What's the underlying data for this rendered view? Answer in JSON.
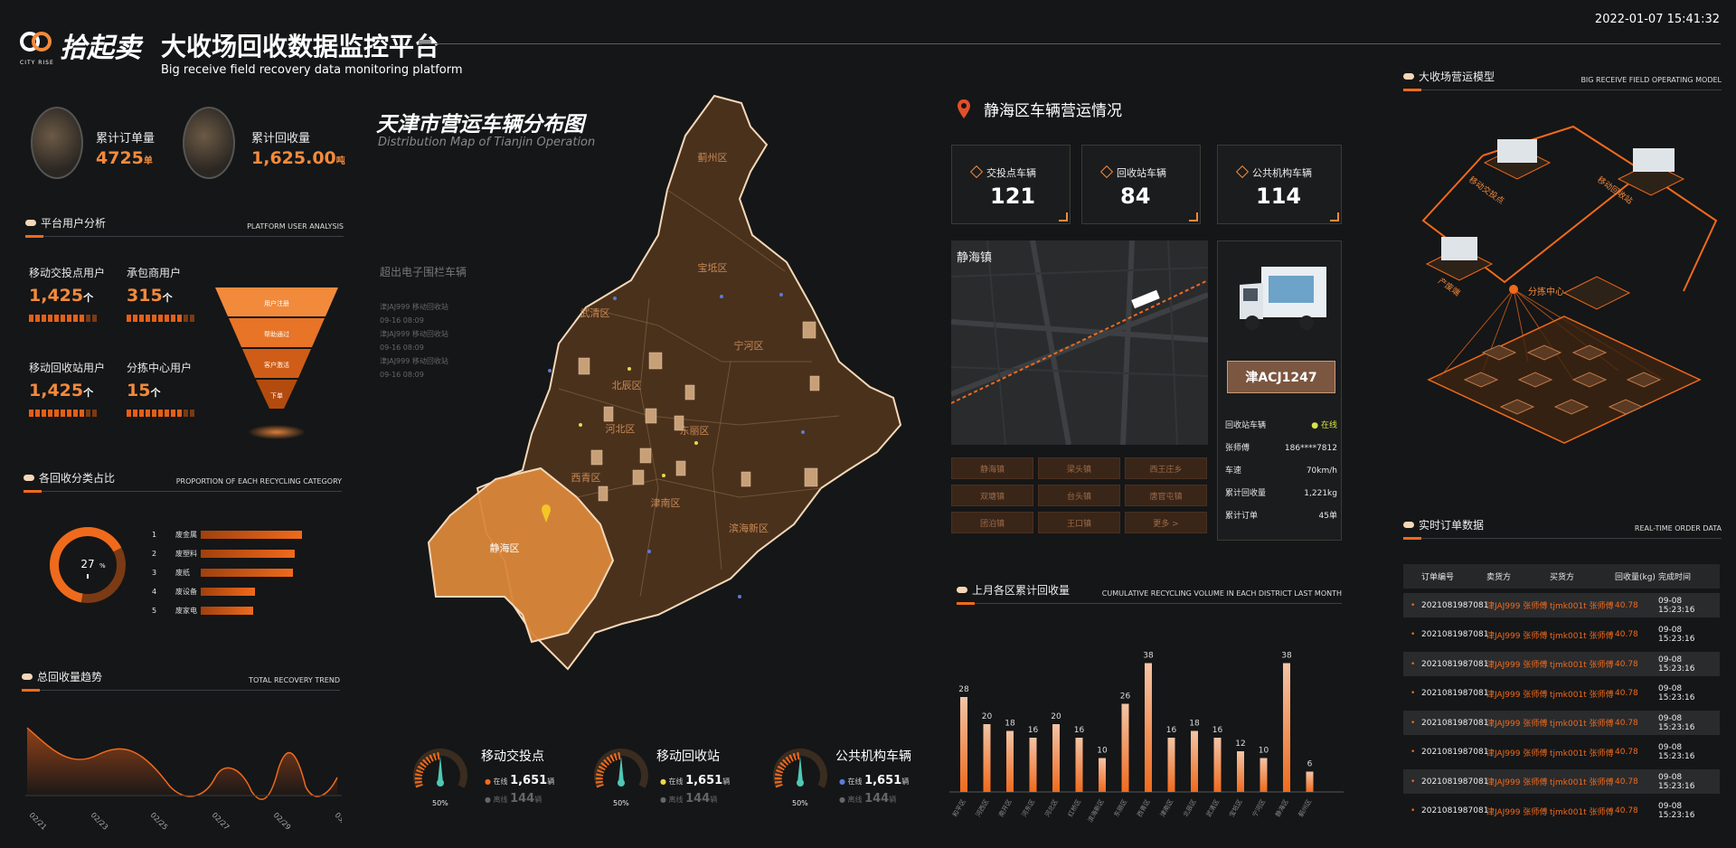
{
  "header": {
    "logo_text": "拾起卖",
    "logo_sub": "CITY RISE",
    "title": "大收场回收数据监控平台",
    "subtitle": "Big receive field recovery data monitoring platform",
    "datetime": "2022-01-07 15:41:32"
  },
  "totals": {
    "orders_label": "累计订单量",
    "orders_value": "4725",
    "orders_unit": "单",
    "recycle_label": "累计回收量",
    "recycle_value": "1,625.00",
    "recycle_unit": "吨"
  },
  "user_analysis": {
    "title": "平台用户分析",
    "title_en": "PLATFORM USER ANALYSIS",
    "items": [
      {
        "label": "移动交投点用户",
        "value": "1,425",
        "unit": "个"
      },
      {
        "label": "承包商用户",
        "value": "315",
        "unit": "个"
      },
      {
        "label": "移动回收站用户",
        "value": "1,425",
        "unit": "个"
      },
      {
        "label": "分拣中心用户",
        "value": "15",
        "unit": "个"
      }
    ],
    "funnel": [
      "用户注册",
      "帮助通过",
      "客户激活",
      "下单"
    ]
  },
  "category": {
    "title": "各回收分类占比",
    "title_en": "PROPORTION OF EACH RECYCLING CATEGORY",
    "center_value": "27",
    "center_unit": "%",
    "items": [
      {
        "rank": "1",
        "name": "废金属",
        "pct": 0.93
      },
      {
        "rank": "2",
        "name": "废塑料",
        "pct": 0.8
      },
      {
        "rank": "3",
        "name": "废纸",
        "pct": 0.78
      },
      {
        "rank": "4",
        "name": "废设备",
        "pct": 0.55
      },
      {
        "rank": "5",
        "name": "废家电",
        "pct": 0.45
      }
    ]
  },
  "trend": {
    "title": "总回收量趋势",
    "title_en": "TOTAL RECOVERY TREND",
    "x_labels": [
      "02/21",
      "02/23",
      "02/25",
      "02/27",
      "02/29",
      "03/02"
    ]
  },
  "map": {
    "title": "天津市营运车辆分布图",
    "title_en": "Distribution Map of Tianjin Operation",
    "fence_title": "超出电子围栏车辆",
    "fence_list": [
      "津JAJ999 移动回收站",
      "09-16 08:09",
      "津JAJ999 移动回收站",
      "09-16 08:09",
      "津JAJ999 移动回收站",
      "09-16 08:09"
    ],
    "districts": [
      "蓟州区",
      "宝坻区",
      "武清区",
      "宁河区",
      "北辰区",
      "东丽区",
      "河北区",
      "西青区",
      "津南区",
      "滨海新区",
      "静海区",
      "红桥区"
    ]
  },
  "gauges": [
    {
      "title": "移动交投点",
      "online_label": "在线",
      "online_value": "1,651",
      "online_unit": "辆",
      "offline_label": "离线",
      "offline_value": "144",
      "offline_unit": "辆",
      "pct": "50%"
    },
    {
      "title": "移动回收站",
      "online_label": "在线",
      "online_value": "1,651",
      "online_unit": "辆",
      "offline_label": "离线",
      "offline_value": "144",
      "offline_unit": "辆",
      "pct": "50%"
    },
    {
      "title": "公共机构车辆",
      "online_label": "在线",
      "online_value": "1,651",
      "online_unit": "辆",
      "offline_label": "离线",
      "offline_value": "144",
      "offline_unit": "辆",
      "pct": "50%"
    }
  ],
  "ops": {
    "title": "静海区车辆营运情况",
    "cards": [
      {
        "label": "交投点车辆",
        "value": "121"
      },
      {
        "label": "回收站车辆",
        "value": "84"
      },
      {
        "label": "公共机构车辆",
        "value": "114"
      }
    ],
    "town": "静海镇",
    "buttons": [
      "静海镇",
      "梁头镇",
      "西王庄乡",
      "双塘镇",
      "台头镇",
      "唐官屯镇",
      "团泊镇",
      "王口镇",
      "更多 >"
    ],
    "plate": "津ACJ1247",
    "info": [
      {
        "k": "回收站车辆",
        "v": "● 在线"
      },
      {
        "k": "张师傅",
        "v": "186****7812"
      },
      {
        "k": "车速",
        "v": "70km/h"
      },
      {
        "k": "累计回收量",
        "v": "1,221kg"
      },
      {
        "k": "累计订单",
        "v": "45单"
      }
    ]
  },
  "chart_data": {
    "type": "bar",
    "title": "上月各区累计回收量",
    "title_en": "CUMULATIVE RECYCLING VOLUME IN EACH DISTRICT LAST MONTH",
    "categories": [
      "和平区",
      "河西区",
      "南开区",
      "河东区",
      "河北区",
      "红桥区",
      "滨海新区",
      "东丽区",
      "西青区",
      "津南区",
      "北辰区",
      "武清区",
      "宝坻区",
      "宁河区",
      "静海区",
      "蓟州区"
    ],
    "values": [
      28,
      20,
      18,
      16,
      20,
      16,
      10,
      26,
      38,
      16,
      18,
      16,
      12,
      10,
      38,
      6
    ],
    "ylim": [
      0,
      40
    ]
  },
  "model": {
    "title": "大收场营运模型",
    "title_en": "BIG RECEIVE FIELD OPERATING MODEL",
    "labels": [
      "移动交投点",
      "移动回收站",
      "产废端",
      "分拣中心"
    ]
  },
  "orders": {
    "title": "实时订单数据",
    "title_en": "REAL-TIME ORDER DATA",
    "headers": [
      "订单编号",
      "卖货方",
      "买货方",
      "回收量(kg)",
      "完成时间"
    ],
    "rows": [
      [
        "2021081987081",
        "津JAJ999 张师傅",
        "tjmk001t 张师傅",
        "40.78",
        "09-08 15:23:16"
      ],
      [
        "2021081987081",
        "津JAJ999 张师傅",
        "tjmk001t 张师傅",
        "40.78",
        "09-08 15:23:16"
      ],
      [
        "2021081987081",
        "津JAJ999 张师傅",
        "tjmk001t 张师傅",
        "40.78",
        "09-08 15:23:16"
      ],
      [
        "2021081987081",
        "津JAJ999 张师傅",
        "tjmk001t 张师傅",
        "40.78",
        "09-08 15:23:16"
      ],
      [
        "2021081987081",
        "津JAJ999 张师傅",
        "tjmk001t 张师傅",
        "40.78",
        "09-08 15:23:16"
      ],
      [
        "2021081987081",
        "津JAJ999 张师傅",
        "tjmk001t 张师傅",
        "40.78",
        "09-08 15:23:16"
      ],
      [
        "2021081987081",
        "津JAJ999 张师傅",
        "tjmk001t 张师傅",
        "40.78",
        "09-08 15:23:16"
      ],
      [
        "2021081987081",
        "津JAJ999 张师傅",
        "tjmk001t 张师傅",
        "40.78",
        "09-08 15:23:16"
      ]
    ]
  }
}
